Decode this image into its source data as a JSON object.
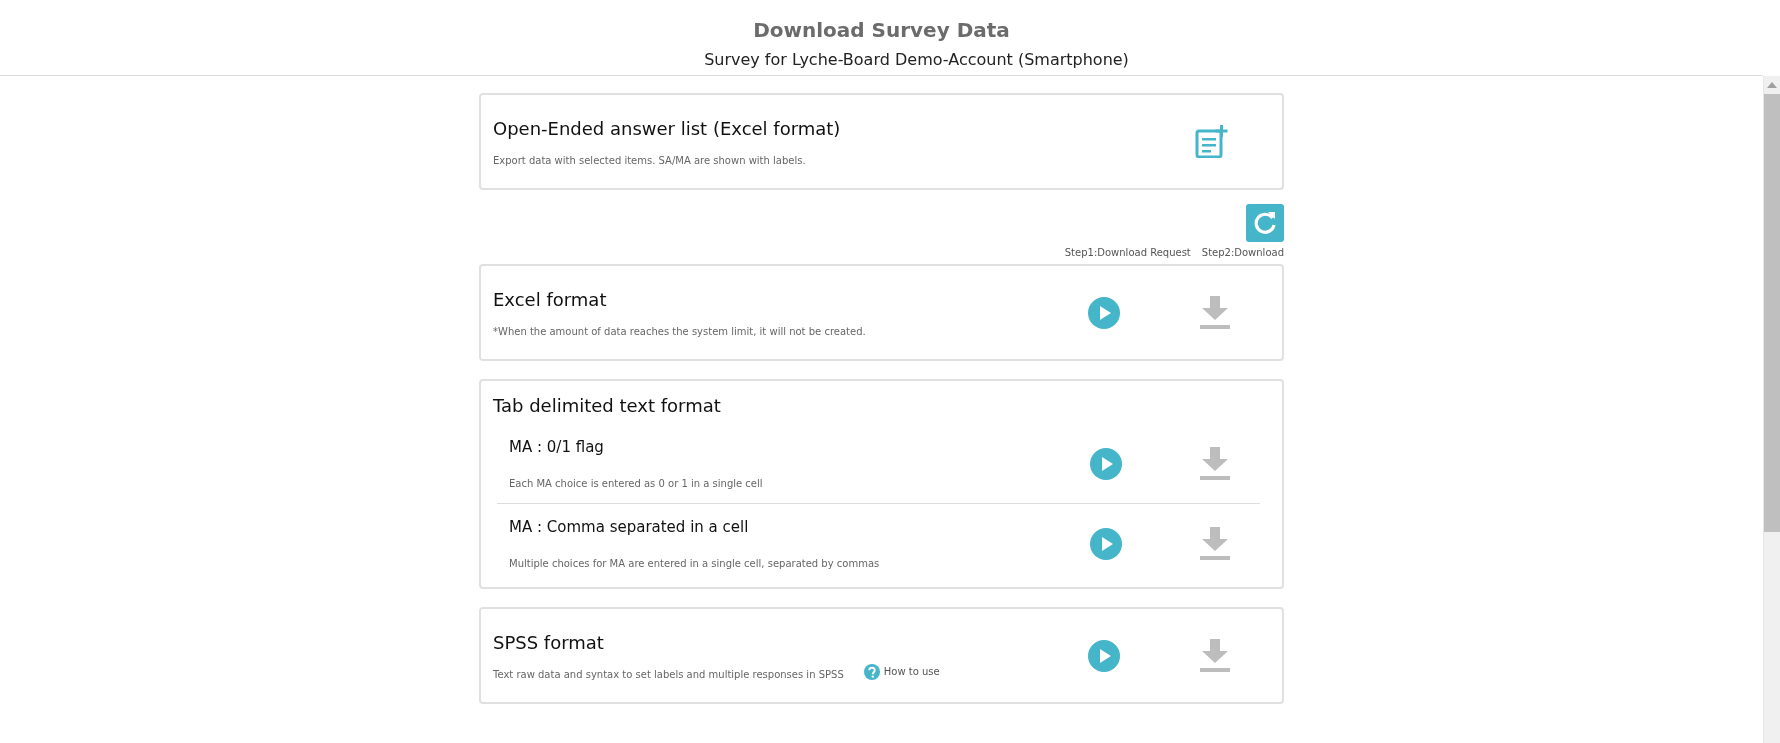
{
  "header": {
    "title": "Download Survey Data",
    "subtitle": "Survey for Lyche-Board Demo-Account (Smartphone)"
  },
  "open_ended": {
    "title": "Open-Ended answer list (Excel format)",
    "description": "Export data with selected items. SA/MA are shown with labels."
  },
  "steps": {
    "labels": [
      "Step1:Download Request",
      "Step2:Download"
    ]
  },
  "cards": [
    {
      "kind": "single",
      "title": "Excel format",
      "description": "*When the amount of data reaches the system limit, it will not be created.",
      "download_disabled": true
    },
    {
      "kind": "group",
      "title": "Tab delimited text format",
      "options": [
        {
          "title": "MA : 0/1 flag",
          "description": "Each MA choice is entered as 0 or 1 in a single cell",
          "download_disabled": true
        },
        {
          "title": "MA : Comma separated in a cell",
          "description": "Multiple choices for MA are entered in a single cell, separated by commas",
          "download_disabled": true
        }
      ]
    },
    {
      "kind": "single",
      "title": "SPSS format",
      "description": "Text raw data and syntax to set labels and multiple responses in SPSS",
      "help_link": "How to use",
      "download_disabled": true
    }
  ]
}
